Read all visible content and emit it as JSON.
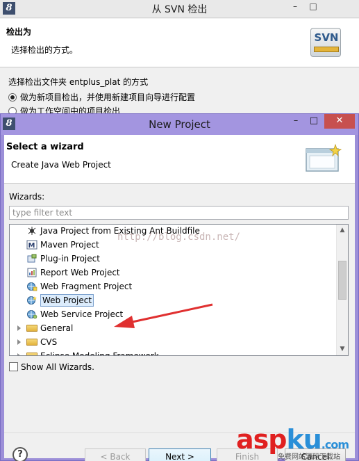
{
  "svn_dialog": {
    "title": "从 SVN 检出",
    "min_glyph": "–",
    "max_glyph": "□",
    "header_title": "检出为",
    "header_description": "选择检出的方式。",
    "prompt": "选择检出文件夹 entplus_plat 的方式",
    "options": [
      {
        "label": "做为新项目检出，并使用新建项目向导进行配置",
        "selected": true
      },
      {
        "label": "做为工作空间中的项目检出",
        "selected": false
      }
    ],
    "logo_text": "SVN"
  },
  "new_project": {
    "title": "New Project",
    "min_glyph": "–",
    "max_glyph": "□",
    "close_glyph": "✕",
    "header_title": "Select a wizard",
    "header_description": "Create Java Web Project",
    "wizards_label": "Wizards:",
    "filter_placeholder": "type filter text",
    "tree_items": [
      {
        "label": "Java Project from Existing Ant Buildfile",
        "icon": "ant-buildfile-icon"
      },
      {
        "label": "Maven Project",
        "icon": "maven-icon"
      },
      {
        "label": "Plug-in Project",
        "icon": "plugin-icon"
      },
      {
        "label": "Report Web Project",
        "icon": "report-icon"
      },
      {
        "label": "Web Fragment Project",
        "icon": "web-fragment-icon"
      },
      {
        "label": "Web Project",
        "icon": "web-project-icon",
        "selected": true
      },
      {
        "label": "Web Service Project",
        "icon": "web-service-icon"
      },
      {
        "label": "General",
        "icon": "folder-icon",
        "folder": true
      },
      {
        "label": "CVS",
        "icon": "folder-icon",
        "folder": true
      },
      {
        "label": "Eclipse Modeling Framework",
        "icon": "folder-icon",
        "folder": true
      }
    ],
    "watermark": "http://blog.csdn.net/",
    "show_all_label": "Show All Wizards.",
    "buttons": {
      "back": "< Back",
      "next": "Next >",
      "finish": "Finish",
      "cancel": "Cancel"
    }
  },
  "site_watermark": {
    "asp": "asp",
    "ku": "ku",
    "com": ".com",
    "subtitle": "免费网站源码下载站"
  },
  "colors": {
    "selection_bg": "#dcecfc",
    "arrow": "#e03030",
    "title_bar": "#a395e0",
    "close": "#c7504f"
  }
}
